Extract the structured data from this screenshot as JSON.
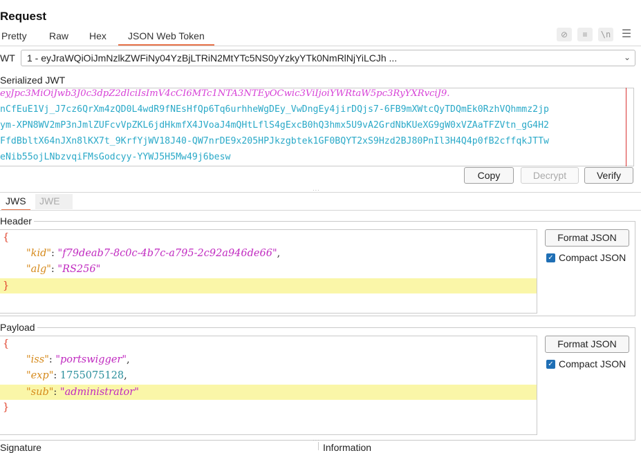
{
  "title": "Request",
  "tabs": [
    {
      "label": "Pretty"
    },
    {
      "label": "Raw"
    },
    {
      "label": "Hex"
    },
    {
      "label": "JSON Web Token"
    }
  ],
  "toolbar_icons": [
    "hide-icon",
    "wrap-icon",
    "newline-icon",
    "menu-icon"
  ],
  "toolbar_icon_glyphs": [
    "⊘",
    "≡",
    "\\n",
    "☰"
  ],
  "jwt_select": {
    "label": "WT",
    "value": "1 - eyJraWQiOiJmNzlkZWFiNy04YzBjLTRiN2MtYTc5NS0yYzkyYTk0NmRlNjYiLCJh ...",
    "arrow": "⌄"
  },
  "serialized": {
    "label": "Serialized JWT",
    "lines": [
      "eyJpc3MiOiJwb3J0c3dpZ2dlciIsImV4cCI6MTc1NTA3NTEyOCwic3ViIjoiYWRtaW5pc3RyYXRvciJ9.",
      "nCfEuE1Vj_J7cz6QrXm4zQD0L4wdR9fNEsHfQp6Tq6urhheWgDEy_VwDngEy4jirDQjs7-6FB9mXWtcQyTDQmEk0RzhVQhmmz2jp",
      "ym-XPN8WV2mP3nJmlZUFcvVpZKL6jdHkmfX4JVoaJ4mQHtLflS4gExcB0hQ3hmx5U9vA2GrdNbKUeXG9gW0xVZAaTFZVtn_gG4H2",
      "FfdBbltX64nJXn8lKX7t_9KrfYjWV18J40-QW7nrDE9x205HPJkzgbtek1GF0BQYT2xS9Hzd2BJ80PnIl3H4Q4p0fB2cffqkJTTw",
      "eNib55ojLNbzvqiFMsGodcyy-YYWJ5H5Mw49j6besw"
    ],
    "buttons": {
      "copy": "Copy",
      "decrypt": "Decrypt",
      "verify": "Verify"
    }
  },
  "jws_tabs": [
    {
      "label": "JWS"
    },
    {
      "label": "JWE"
    }
  ],
  "header": {
    "label": "Header",
    "kid_key": "\"kid\"",
    "kid_value": "\"f79deab7-8c0c-4b7c-a795-2c92a946de66\"",
    "alg_key": "\"alg\"",
    "alg_value": "\"RS256\"",
    "format_button": "Format JSON",
    "compact_label": "Compact JSON",
    "compact_checked": true
  },
  "payload": {
    "label": "Payload",
    "iss_key": "\"iss\"",
    "iss_value": "\"portswigger\"",
    "exp_key": "\"exp\"",
    "exp_value": "1755075128",
    "sub_key": "\"sub\"",
    "sub_value": "\"administrator\"",
    "format_button": "Format JSON",
    "compact_label": "Compact JSON",
    "compact_checked": true
  },
  "bottom": {
    "signature_label": "Signature",
    "information_label": "Information"
  },
  "colors": {
    "accent": "#e8734a",
    "highlight": "#faf6a8",
    "checkbox": "#1f6fb5"
  }
}
